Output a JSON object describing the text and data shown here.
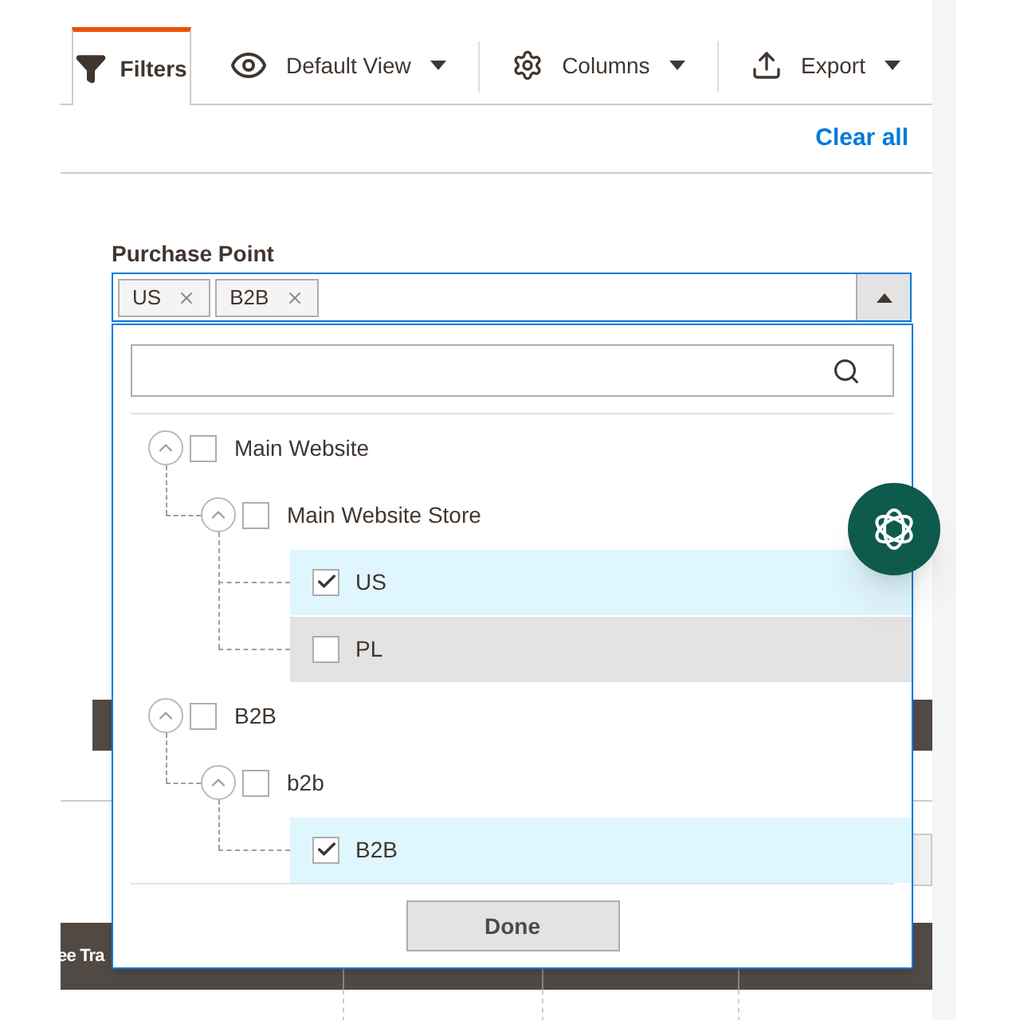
{
  "tabs": [
    {
      "label": "Filters",
      "selected": true,
      "kind": "filter",
      "caret": false
    },
    {
      "label": "Default View",
      "selected": false,
      "kind": "view",
      "caret": true
    },
    {
      "label": "Columns",
      "selected": false,
      "kind": "columns",
      "caret": true
    },
    {
      "label": "Export",
      "selected": false,
      "kind": "export",
      "caret": true
    }
  ],
  "clear_all": "Clear all",
  "purchase_point": {
    "label": "Purchase Point",
    "expanded": true,
    "tags": [
      "US",
      "B2B"
    ],
    "tree": [
      {
        "label": "Main Website",
        "checked": false,
        "expanded": true,
        "children": [
          {
            "label": "Main Website Store",
            "checked": false,
            "expanded": true,
            "children": [
              {
                "label": "US",
                "checked": true,
                "hovered": false
              },
              {
                "label": "PL",
                "checked": false,
                "hovered": true
              }
            ]
          }
        ]
      },
      {
        "label": "B2B",
        "checked": false,
        "expanded": true,
        "children": [
          {
            "label": "b2b",
            "checked": false,
            "expanded": true,
            "children": [
              {
                "label": "B2B",
                "checked": true,
                "hovered": false
              }
            ]
          }
        ]
      }
    ],
    "done_button": "Done"
  },
  "table": {
    "columns": [
      "ee Tra"
    ]
  }
}
